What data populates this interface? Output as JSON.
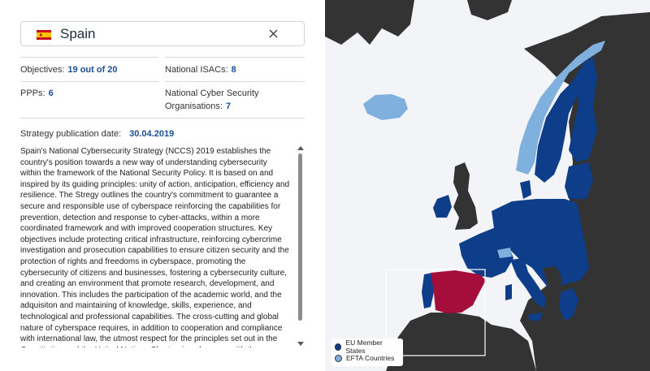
{
  "search": {
    "country": "Spain",
    "flag_icon": "spain-flag-icon",
    "clear_icon": "close-icon"
  },
  "stats": {
    "objectives_label": "Objectives:",
    "objectives_value": "19 out of 20",
    "isacs_label": "National ISACs:",
    "isacs_value": "8",
    "ppps_label": "PPPs:",
    "ppps_value": "6",
    "ncso_label_line1": "National Cyber Security",
    "ncso_label_line2": "Organisations:",
    "ncso_value": "7",
    "date_label": "Strategy publication date:",
    "date_value": "30.04.2019"
  },
  "description": "Spain's National Cybersecurity Strategy (NCCS) 2019 establishes the country's position towards a new way of understanding cybersecurity within the framework of the National Security Policy. It is based on and inspired by its guiding principles: unity of action, anticipation, efficiency and resilience. The Stregy outlines the country's commitment to guarantee a secure and responsible use of cyberspace reinforcing the capabilities for prevention, detection and response to cyber-attacks, within a more coordinated framework and with improved cooperation structures. Key objectives include protecting critical infrastructure, reinforcing cybercrime investigation and prosecution capabilities to ensure citizen security and the protection of rights and freedoms in cyberspace, promoting the cybersecurity of citizens and businesses, fostering a cybersecurity culture, and creating an environment that promote research, development, and innovation. This includes the participation of the academic world, and the adquisiton and maintaining of knowledge, skills, experience, and technological and professional capabilities. The cross-cutting and global nature of cyberspace requires, in addition to cooperation and compliance with international law, the utmost respect for the principles set out in the Constitution and the United Nations Charter; in coherence with the National",
  "legend": {
    "eu_label": "EU Member States",
    "efta_label": "EFTA Countries"
  },
  "colors": {
    "eu": "#0e3e8a",
    "efta": "#7fb0de",
    "selected": "#a50d3a",
    "non_member": "#333333",
    "sea": "#f2f4f7",
    "accent_text": "#1b4f93"
  }
}
